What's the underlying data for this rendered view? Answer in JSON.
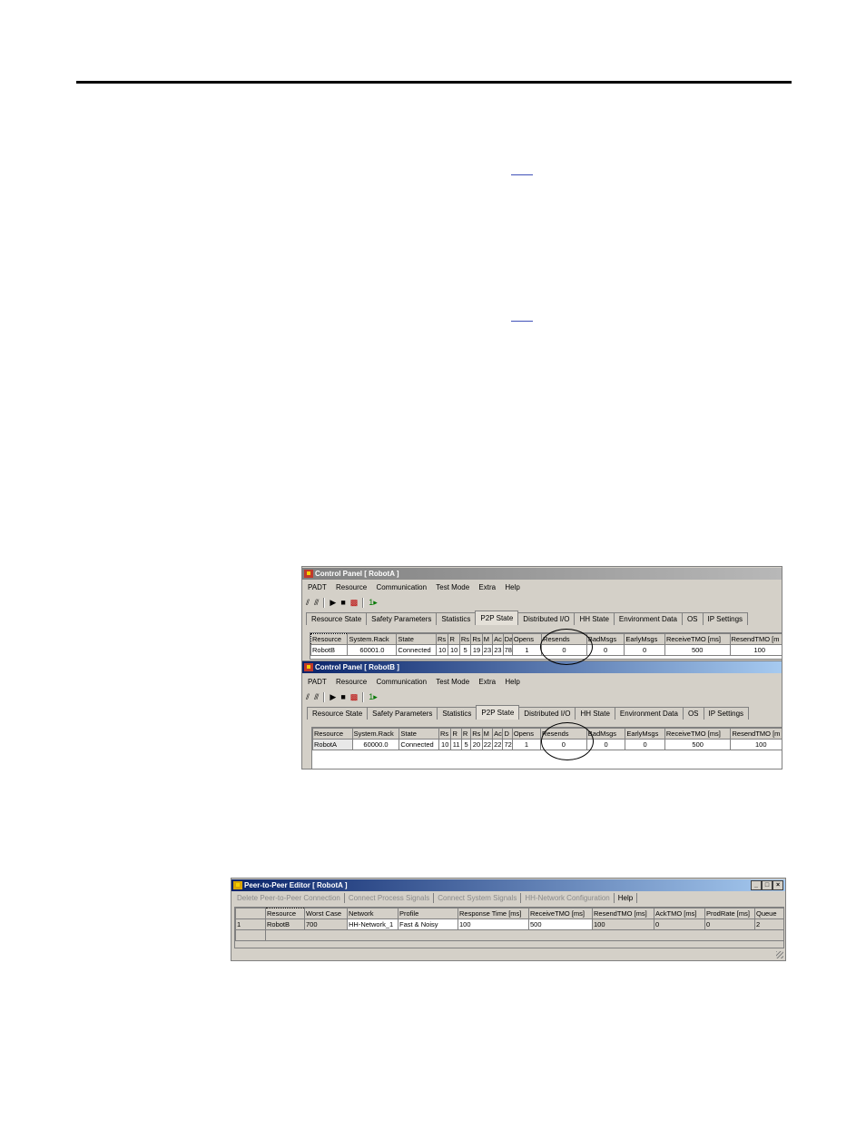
{
  "windowA": {
    "title": "Control Panel [ RobotA ]",
    "menu": [
      "PADT",
      "Resource",
      "Communication",
      "Test Mode",
      "Extra",
      "Help"
    ],
    "tabs": [
      "Resource State",
      "Safety Parameters",
      "Statistics",
      "P2P State",
      "Distributed I/O",
      "HH State",
      "Environment Data",
      "OS",
      "IP Settings"
    ],
    "active_tab": "P2P State",
    "columns": [
      "Resource",
      "System.Rack",
      "State",
      "Rs",
      "R",
      "Rs",
      "Rs",
      "M",
      "Ac",
      "Da",
      "Opens",
      "Resends",
      "BadMsgs",
      "EarlyMsgs",
      "ReceiveTMO [ms]",
      "ResendTMO [m"
    ],
    "rows": [
      [
        "RobotB",
        "60001.0",
        "Connected",
        "10",
        "10",
        "5",
        "19",
        "23",
        "23",
        "78",
        "1",
        "0",
        "0",
        "0",
        "500",
        "100"
      ]
    ]
  },
  "windowB": {
    "title": "Control Panel [ RobotB ]",
    "menu": [
      "PADT",
      "Resource",
      "Communication",
      "Test Mode",
      "Extra",
      "Help"
    ],
    "tabs": [
      "Resource State",
      "Safety Parameters",
      "Statistics",
      "P2P State",
      "Distributed I/O",
      "HH State",
      "Environment Data",
      "OS",
      "IP Settings"
    ],
    "active_tab": "P2P State",
    "columns": [
      "Resource",
      "System.Rack",
      "State",
      "Rs",
      "R",
      "R",
      "Rs",
      "M",
      "Ac",
      "D",
      "Opens",
      "Resends",
      "BadMsgs",
      "EarlyMsgs",
      "ReceiveTMO [ms]",
      "ResendTMO [m"
    ],
    "rows": [
      [
        "RobotA",
        "60000.0",
        "Connected",
        "10",
        "11",
        "5",
        "20",
        "22",
        "22",
        "72",
        "1",
        "0",
        "0",
        "0",
        "500",
        "100"
      ]
    ]
  },
  "p2p": {
    "title": "Peer-to-Peer Editor [ RobotA ]",
    "toolbar": [
      "Delete Peer-to-Peer Connection",
      "Connect Process Signals",
      "Connect System Signals",
      "HH-Network Configuration",
      "Help"
    ],
    "columns": [
      "",
      "Resource",
      "Worst Case",
      "Network",
      "Profile",
      "Response Time [ms]",
      "ReceiveTMO [ms]",
      "ResendTMO [ms]",
      "AckTMO [ms]",
      "ProdRate [ms]",
      "Queue"
    ],
    "rows": [
      [
        "1",
        "RobotB",
        "700",
        "HH-Network_1",
        "Fast & Noisy",
        "100",
        "500",
        "100",
        "0",
        "0",
        "2"
      ]
    ]
  },
  "icons": {
    "app": "control-panel-icon",
    "tools": [
      "connect-icon",
      "disconnect-icon",
      "run-icon",
      "stop-icon",
      "device-icon",
      "step-icon"
    ]
  }
}
